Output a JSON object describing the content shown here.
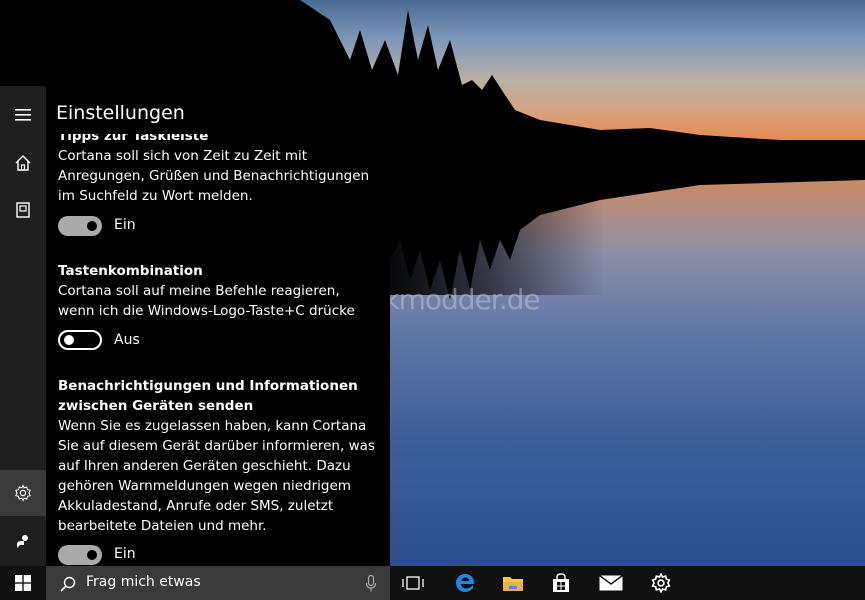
{
  "panel": {
    "title": "Einstellungen",
    "sections": [
      {
        "title": "Tipps zur Taskleiste",
        "text": "Cortana soll sich von Zeit zu Zeit mit Anregungen, Grüßen und Benachrichtigungen im Suchfeld zu Wort melden.",
        "toggle_label": "Ein",
        "toggle_on": true
      },
      {
        "title": "Tastenkombination",
        "text": "Cortana soll auf meine Befehle reagieren, wenn ich die Windows-Logo-Taste+C drücke",
        "toggle_label": "Aus",
        "toggle_on": false
      },
      {
        "title": "Benachrichtigungen und Informationen zwischen Geräten senden",
        "text": "Wenn Sie es zugelassen haben, kann Cortana Sie auf diesem Gerät darüber informieren, was auf Ihren anderen Geräten geschieht. Dazu gehören Warnmeldungen wegen niedrigem Akkuladestand, Anrufe oder SMS, zuletzt bearbeitete Dateien und mehr.",
        "toggle_label": "Ein",
        "toggle_on": true
      }
    ]
  },
  "sidebar": {
    "items": [
      "menu-icon",
      "home-icon",
      "notebook-icon",
      "settings-icon",
      "feedback-icon"
    ],
    "active": "settings-icon"
  },
  "taskbar": {
    "search_placeholder": "Frag mich etwas",
    "icons": [
      "windows-start-icon",
      "search-icon",
      "microphone-icon",
      "task-view-icon",
      "edge-icon",
      "file-explorer-icon",
      "store-icon",
      "mail-icon",
      "settings-icon"
    ]
  },
  "watermark": "Deskmodder.de",
  "colors": {
    "panel_bg": "#000000",
    "sidebar_bg": "#1f1f1f",
    "taskbar_bg": "#101010",
    "search_bg": "#3a3a3a",
    "edge_blue": "#1e88e5",
    "explorer_yellow": "#f2c94c"
  }
}
